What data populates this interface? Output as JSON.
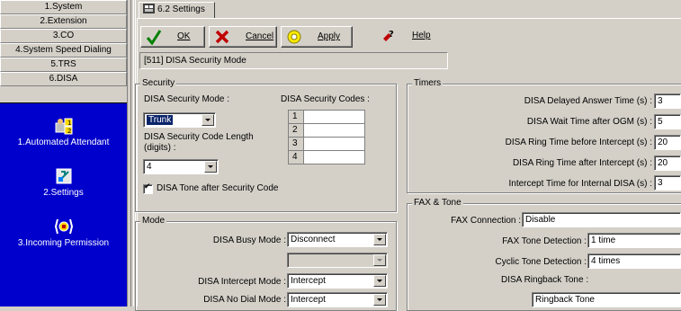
{
  "nav": {
    "items": [
      {
        "label": "1.System"
      },
      {
        "label": "2.Extension"
      },
      {
        "label": "3.CO"
      },
      {
        "label": "4.System Speed Dialing"
      },
      {
        "label": "5.TRS"
      },
      {
        "label": "6.DISA"
      }
    ],
    "panel_items": [
      {
        "label": "1.Automated Attendant",
        "icon": "automated-attendant-icon"
      },
      {
        "label": "2.Settings",
        "icon": "settings-icon"
      },
      {
        "label": "3.Incoming Permission",
        "icon": "incoming-permission-icon"
      }
    ]
  },
  "tab": {
    "label": "6.2 Settings"
  },
  "toolbar": {
    "ok_label": "OK",
    "cancel_label": "Cancel",
    "apply_label": "Apply",
    "help_label": "Help"
  },
  "info": {
    "text": "[511] DISA Security Mode"
  },
  "security": {
    "title": "Security",
    "mode_label": "DISA Security Mode :",
    "mode_value": "Trunk",
    "codes_label": "DISA Security Codes :",
    "codes": [
      {
        "num": "1",
        "value": ""
      },
      {
        "num": "2",
        "value": ""
      },
      {
        "num": "3",
        "value": ""
      },
      {
        "num": "4",
        "value": ""
      }
    ],
    "code_length_label_1": "DISA Security Code Length",
    "code_length_label_2": "(digits) :",
    "code_length_value": "4",
    "tone_label": "DISA Tone after Security Code",
    "tone_checked": true
  },
  "timers": {
    "title": "Timers",
    "fields": [
      {
        "label": "DISA Delayed Answer Time (s) :",
        "value": "3"
      },
      {
        "label": "DISA Wait Time after OGM (s) :",
        "value": "5"
      },
      {
        "label": "DISA Ring Time before Intercept (s) :",
        "value": "20"
      },
      {
        "label": "DISA Ring Time after Intercept (s) :",
        "value": "20"
      },
      {
        "label": "Intercept Time for Internal DISA (s) :",
        "value": "3"
      }
    ]
  },
  "mode": {
    "title": "Mode",
    "busy_label": "DISA Busy Mode :",
    "busy_value": "Disconnect",
    "blank_value": "",
    "intercept_label": "DISA Intercept Mode :",
    "intercept_value": "Intercept",
    "nodial_label": "DISA No Dial Mode :",
    "nodial_value": "Intercept"
  },
  "fax": {
    "title": "FAX & Tone",
    "connection_label": "FAX Connection :",
    "connection_value": "Disable",
    "detection_label": "FAX Tone Detection :",
    "detection_value": "1 time",
    "cyclic_label": "Cyclic Tone Detection :",
    "cyclic_value": "4 times",
    "ringback_label": "DISA Ringback Tone :",
    "ringback_value": "Ringback Tone"
  },
  "colors": {
    "background": "#d4d0c8",
    "nav_panel": "#0000cc",
    "selection": "#0a246a"
  }
}
